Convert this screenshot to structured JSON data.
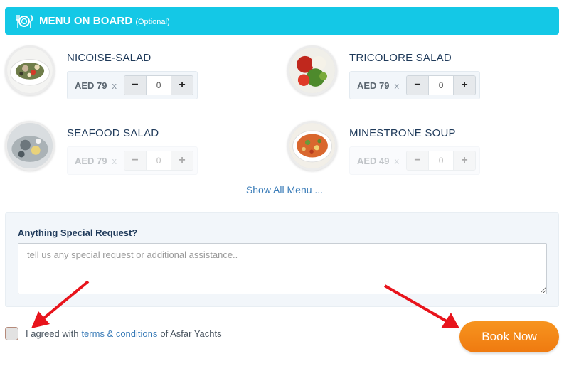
{
  "header": {
    "title": "MENU ON BOARD",
    "optional": "(Optional)",
    "icon": "cutlery-plate-icon"
  },
  "menu_items": [
    {
      "name": "NICOISE-SALAD",
      "price": "AED 79",
      "times": "x",
      "qty": "0",
      "minus": "−",
      "plus": "+",
      "enabled": true
    },
    {
      "name": "TRICOLORE SALAD",
      "price": "AED 79",
      "times": "x",
      "qty": "0",
      "minus": "−",
      "plus": "+",
      "enabled": true
    },
    {
      "name": "SEAFOOD SALAD",
      "price": "AED 79",
      "times": "x",
      "qty": "0",
      "minus": "−",
      "plus": "+",
      "enabled": false
    },
    {
      "name": "MINESTRONE SOUP",
      "price": "AED 49",
      "times": "x",
      "qty": "0",
      "minus": "−",
      "plus": "+",
      "enabled": false
    }
  ],
  "show_all": "Show All Menu ...",
  "special_request": {
    "label": "Anything Special Request?",
    "placeholder": "tell us any special request or additional assistance.."
  },
  "agreement": {
    "prefix": "I agreed with",
    "link": "terms & conditions",
    "suffix": "of Asfar Yachts"
  },
  "book_button": "Book Now",
  "colors": {
    "header_bg": "#14c8e6",
    "book_button": "#f58a1b",
    "link": "#3a7cb8",
    "annotation_arrow": "#e8141c"
  }
}
